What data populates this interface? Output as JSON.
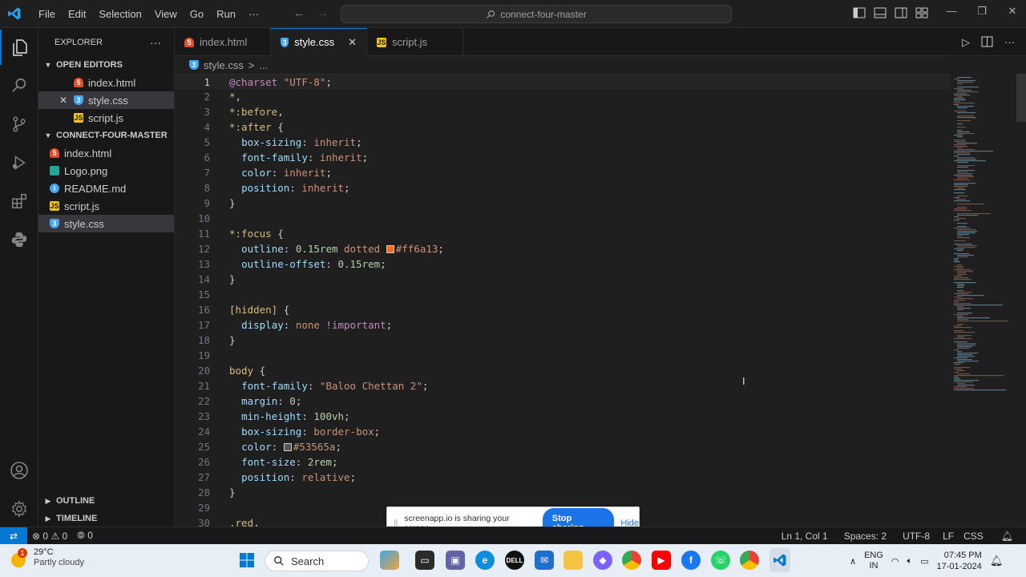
{
  "menu": [
    "File",
    "Edit",
    "Selection",
    "View",
    "Go",
    "Run",
    "···"
  ],
  "command_center": {
    "text": "connect-four-master"
  },
  "sidebar": {
    "title": "EXPLORER",
    "more": "···",
    "open_editors": {
      "label": "OPEN EDITORS",
      "items": [
        {
          "name": "index.html",
          "type": "html"
        },
        {
          "name": "style.css",
          "type": "css",
          "close": "✕"
        },
        {
          "name": "script.js",
          "type": "js"
        }
      ]
    },
    "folder": {
      "label": "CONNECT-FOUR-MASTER",
      "items": [
        {
          "name": "index.html",
          "type": "html"
        },
        {
          "name": "Logo.png",
          "type": "png"
        },
        {
          "name": "README.md",
          "type": "md"
        },
        {
          "name": "script.js",
          "type": "js"
        },
        {
          "name": "style.css",
          "type": "css"
        }
      ]
    },
    "outline": "OUTLINE",
    "timeline": "TIMELINE"
  },
  "tabs": [
    {
      "label": "index.html",
      "type": "html"
    },
    {
      "label": "style.css",
      "type": "css",
      "close": "✕"
    },
    {
      "label": "script.js",
      "type": "js"
    }
  ],
  "breadcrumb": {
    "file": "style.css",
    "sep": ">",
    "rest": "..."
  },
  "code_lines": [
    {
      "n": "1",
      "tokens": [
        [
          "t-at",
          "@charset"
        ],
        [
          "t-pun",
          " "
        ],
        [
          "t-str",
          "\"UTF-8\""
        ],
        [
          "t-pun",
          ";"
        ]
      ]
    },
    {
      "n": "2",
      "tokens": [
        [
          "t-sel",
          "*"
        ],
        [
          "t-pun",
          ","
        ]
      ]
    },
    {
      "n": "3",
      "tokens": [
        [
          "t-sel",
          "*:before"
        ],
        [
          "t-pun",
          ","
        ]
      ]
    },
    {
      "n": "4",
      "tokens": [
        [
          "t-sel",
          "*:after"
        ],
        [
          "t-pun",
          " {"
        ]
      ]
    },
    {
      "n": "5",
      "tokens": [
        [
          "t-pun",
          "  "
        ],
        [
          "t-prop",
          "box-sizing"
        ],
        [
          "t-pun",
          ": "
        ],
        [
          "t-val",
          "inherit"
        ],
        [
          "t-pun",
          ";"
        ]
      ]
    },
    {
      "n": "6",
      "tokens": [
        [
          "t-pun",
          "  "
        ],
        [
          "t-prop",
          "font-family"
        ],
        [
          "t-pun",
          ": "
        ],
        [
          "t-val",
          "inherit"
        ],
        [
          "t-pun",
          ";"
        ]
      ]
    },
    {
      "n": "7",
      "tokens": [
        [
          "t-pun",
          "  "
        ],
        [
          "t-prop",
          "color"
        ],
        [
          "t-pun",
          ": "
        ],
        [
          "t-val",
          "inherit"
        ],
        [
          "t-pun",
          ";"
        ]
      ]
    },
    {
      "n": "8",
      "tokens": [
        [
          "t-pun",
          "  "
        ],
        [
          "t-prop",
          "position"
        ],
        [
          "t-pun",
          ": "
        ],
        [
          "t-val",
          "inherit"
        ],
        [
          "t-pun",
          ";"
        ]
      ]
    },
    {
      "n": "9",
      "tokens": [
        [
          "t-pun",
          "}"
        ]
      ]
    },
    {
      "n": "10",
      "tokens": []
    },
    {
      "n": "11",
      "tokens": [
        [
          "t-sel",
          "*:focus"
        ],
        [
          "t-pun",
          " {"
        ]
      ]
    },
    {
      "n": "12",
      "tokens": [
        [
          "t-pun",
          "  "
        ],
        [
          "t-prop",
          "outline"
        ],
        [
          "t-pun",
          ": "
        ],
        [
          "t-num",
          "0.15rem"
        ],
        [
          "t-pun",
          " "
        ],
        [
          "t-val",
          "dotted"
        ],
        [
          "t-pun",
          " "
        ],
        [
          "swatch",
          "#ff6a13"
        ],
        [
          "t-val",
          "#ff6a13"
        ],
        [
          "t-pun",
          ";"
        ]
      ]
    },
    {
      "n": "13",
      "tokens": [
        [
          "t-pun",
          "  "
        ],
        [
          "t-prop",
          "outline-offset"
        ],
        [
          "t-pun",
          ": "
        ],
        [
          "t-num",
          "0.15rem"
        ],
        [
          "t-pun",
          ";"
        ]
      ]
    },
    {
      "n": "14",
      "tokens": [
        [
          "t-pun",
          "}"
        ]
      ]
    },
    {
      "n": "15",
      "tokens": []
    },
    {
      "n": "16",
      "tokens": [
        [
          "t-sel",
          "[hidden]"
        ],
        [
          "t-pun",
          " {"
        ]
      ]
    },
    {
      "n": "17",
      "tokens": [
        [
          "t-pun",
          "  "
        ],
        [
          "t-prop",
          "display"
        ],
        [
          "t-pun",
          ": "
        ],
        [
          "t-val",
          "none"
        ],
        [
          "t-pun",
          " "
        ],
        [
          "t-kw",
          "!important"
        ],
        [
          "t-pun",
          ";"
        ]
      ]
    },
    {
      "n": "18",
      "tokens": [
        [
          "t-pun",
          "}"
        ]
      ]
    },
    {
      "n": "19",
      "tokens": []
    },
    {
      "n": "20",
      "tokens": [
        [
          "t-sel",
          "body"
        ],
        [
          "t-pun",
          " {"
        ]
      ]
    },
    {
      "n": "21",
      "tokens": [
        [
          "t-pun",
          "  "
        ],
        [
          "t-prop",
          "font-family"
        ],
        [
          "t-pun",
          ": "
        ],
        [
          "t-str",
          "\"Baloo Chettan 2\""
        ],
        [
          "t-pun",
          ";"
        ]
      ]
    },
    {
      "n": "22",
      "tokens": [
        [
          "t-pun",
          "  "
        ],
        [
          "t-prop",
          "margin"
        ],
        [
          "t-pun",
          ": "
        ],
        [
          "t-num",
          "0"
        ],
        [
          "t-pun",
          ";"
        ]
      ]
    },
    {
      "n": "23",
      "tokens": [
        [
          "t-pun",
          "  "
        ],
        [
          "t-prop",
          "min-height"
        ],
        [
          "t-pun",
          ": "
        ],
        [
          "t-num",
          "100vh"
        ],
        [
          "t-pun",
          ";"
        ]
      ]
    },
    {
      "n": "24",
      "tokens": [
        [
          "t-pun",
          "  "
        ],
        [
          "t-prop",
          "box-sizing"
        ],
        [
          "t-pun",
          ": "
        ],
        [
          "t-val",
          "border-box"
        ],
        [
          "t-pun",
          ";"
        ]
      ]
    },
    {
      "n": "25",
      "tokens": [
        [
          "t-pun",
          "  "
        ],
        [
          "t-prop",
          "color"
        ],
        [
          "t-pun",
          ": "
        ],
        [
          "swatch",
          "#53565a"
        ],
        [
          "t-val",
          "#53565a"
        ],
        [
          "t-pun",
          ";"
        ]
      ]
    },
    {
      "n": "26",
      "tokens": [
        [
          "t-pun",
          "  "
        ],
        [
          "t-prop",
          "font-size"
        ],
        [
          "t-pun",
          ": "
        ],
        [
          "t-num",
          "2rem"
        ],
        [
          "t-pun",
          ";"
        ]
      ]
    },
    {
      "n": "27",
      "tokens": [
        [
          "t-pun",
          "  "
        ],
        [
          "t-prop",
          "position"
        ],
        [
          "t-pun",
          ": "
        ],
        [
          "t-val",
          "relative"
        ],
        [
          "t-pun",
          ";"
        ]
      ]
    },
    {
      "n": "28",
      "tokens": [
        [
          "t-pun",
          "}"
        ]
      ]
    },
    {
      "n": "29",
      "tokens": []
    },
    {
      "n": "30",
      "tokens": [
        [
          "t-sel",
          ".red"
        ],
        [
          "t-pun",
          ","
        ]
      ]
    }
  ],
  "share_banner": {
    "grip": "||",
    "message": "screenapp.io is sharing your screen.",
    "stop": "Stop sharing",
    "hide": "Hide"
  },
  "status": {
    "errors": "0",
    "warnings": "0",
    "ports": "0",
    "position": "Ln 1, Col 1",
    "spaces": "Spaces: 2",
    "encoding": "UTF-8",
    "eol": "LF",
    "language": "CSS"
  },
  "taskbar": {
    "weather": {
      "temp": "29°C",
      "desc": "Partly cloudy",
      "badge": "1"
    },
    "search": "Search",
    "tray": {
      "lang1": "ENG",
      "lang2": "IN",
      "time": "07:45 PM",
      "date": "17-01-2024"
    }
  },
  "colors": {
    "accent": "#0078d4",
    "swatch_orange": "#ff6a13",
    "swatch_gray": "#53565a"
  }
}
